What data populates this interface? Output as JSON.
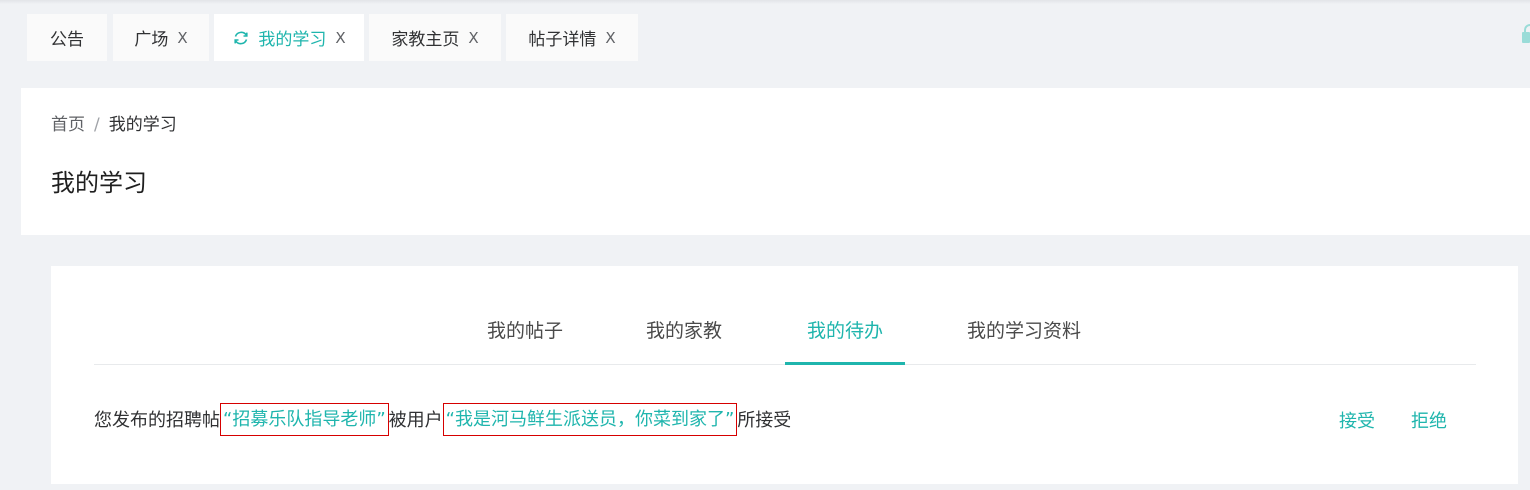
{
  "tabs": [
    {
      "label": "公告",
      "closable": false,
      "active": false
    },
    {
      "label": "广场",
      "closable": true,
      "active": false
    },
    {
      "label": "我的学习",
      "closable": true,
      "active": true
    },
    {
      "label": "家教主页",
      "closable": true,
      "active": false
    },
    {
      "label": "帖子详情",
      "closable": true,
      "active": false
    }
  ],
  "close_glyph": "X",
  "breadcrumb": {
    "home": "首页",
    "separator": "/",
    "current": "我的学习"
  },
  "page_title": "我的学习",
  "content_tabs": [
    {
      "label": "我的帖子",
      "active": false
    },
    {
      "label": "我的家教",
      "active": false
    },
    {
      "label": "我的待办",
      "active": true
    },
    {
      "label": "我的学习资料",
      "active": false
    }
  ],
  "todo": {
    "prefix": "您发布的招聘帖",
    "post_title": "“招募乐队指导老师”",
    "middle": "被用户",
    "user_name": "“我是河马鲜生派送员，你菜到家了”",
    "suffix": "所接受",
    "accept_label": "接受",
    "reject_label": "拒绝"
  },
  "colors": {
    "accent": "#1fb5ad",
    "highlight_border": "#d60000"
  },
  "icons": {
    "active_tab": "refresh-icon",
    "tab_close": "close-icon",
    "right_edge": "lock-icon"
  }
}
